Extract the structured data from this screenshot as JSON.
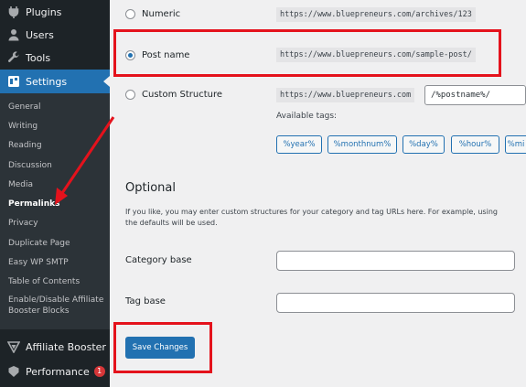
{
  "sidebar": {
    "top_items": [
      {
        "label": "Plugins",
        "icon": "plug-icon"
      },
      {
        "label": "Users",
        "icon": "user-icon"
      },
      {
        "label": "Tools",
        "icon": "wrench-icon"
      },
      {
        "label": "Settings",
        "icon": "settings-icon"
      }
    ],
    "submenu": [
      "General",
      "Writing",
      "Reading",
      "Discussion",
      "Media",
      "Permalinks",
      "Privacy",
      "Duplicate Page",
      "Easy WP SMTP",
      "Table of Contents",
      "Enable/Disable Affiliate Booster Blocks"
    ],
    "current": "Permalinks",
    "bottom_items": [
      {
        "label": "Affiliate Booster",
        "icon": "affiliate-booster-icon"
      },
      {
        "label": "Performance",
        "icon": "performance-icon",
        "badge": "1"
      }
    ]
  },
  "permalinks": {
    "numeric": {
      "label": "Numeric",
      "example": "https://www.bluepreneurs.com/archives/123"
    },
    "post_name": {
      "label": "Post name",
      "example": "https://www.bluepreneurs.com/sample-post/"
    },
    "custom": {
      "label": "Custom Structure",
      "base": "https://www.bluepreneurs.com",
      "value": "/%postname%/"
    },
    "available_tags_label": "Available tags:",
    "tags": [
      "%year%",
      "%monthnum%",
      "%day%",
      "%hour%",
      "%mi"
    ]
  },
  "optional": {
    "title": "Optional",
    "description": "If you like, you may enter custom structures for your category and tag URLs here. For example, using",
    "description_line2": "the defaults will be used.",
    "category_base_label": "Category base",
    "tag_base_label": "Tag base",
    "category_base_value": "",
    "tag_base_value": ""
  },
  "save_label": "Save Changes",
  "colors": {
    "accent": "#2271b1",
    "sidebar": "#1d2327",
    "annotation": "#e4121c",
    "badge": "#d63638"
  }
}
